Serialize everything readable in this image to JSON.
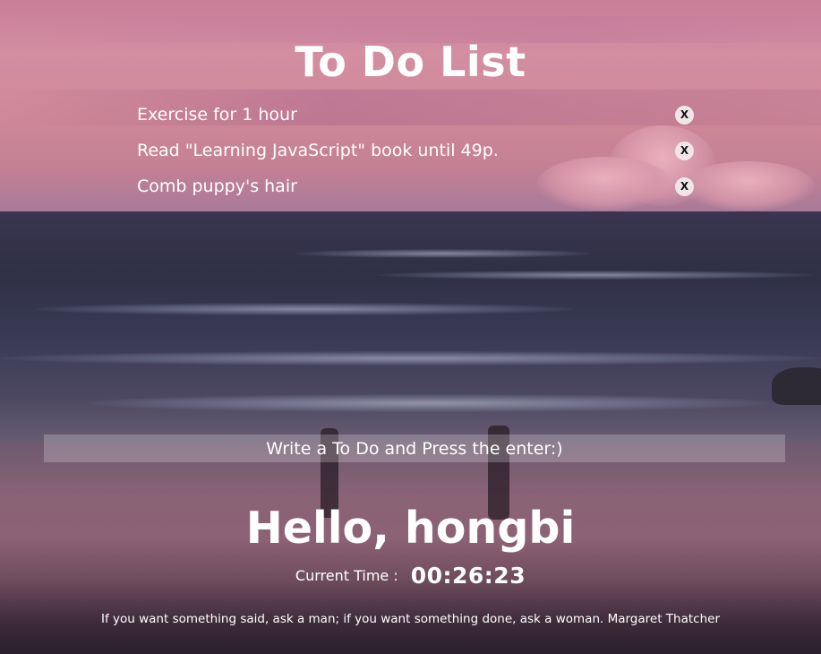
{
  "title": "To Do List",
  "todos": [
    {
      "text": "Exercise for 1 hour",
      "delete_label": "X"
    },
    {
      "text": "Read \"Learning JavaScript\" book until 49p.",
      "delete_label": "X"
    },
    {
      "text": "Comb puppy's hair",
      "delete_label": "X"
    }
  ],
  "input": {
    "placeholder": "Write a To Do and Press the enter:)",
    "value": ""
  },
  "greeting": "Hello, hongbi",
  "clock": {
    "label": "Current Time :",
    "time": "00:26:23"
  },
  "quote": "If you want something said, ask a man; if you want something done, ask a woman. Margaret Thatcher",
  "colors": {
    "text": "#ffffff",
    "delete_button_bg": "#f0e6ea",
    "input_bg": "rgba(255,255,255,0.22)"
  }
}
